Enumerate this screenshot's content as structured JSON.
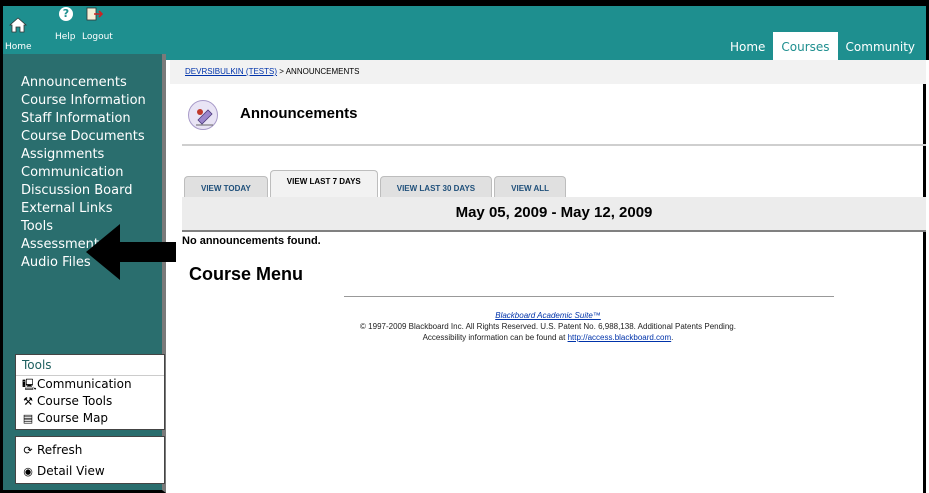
{
  "topbar": {
    "home_label": "Home",
    "help_label": "Help",
    "logout_label": "Logout",
    "help_glyph": "?",
    "tabs": [
      {
        "label": "Home",
        "active": false
      },
      {
        "label": "Courses",
        "active": true
      },
      {
        "label": "Community",
        "active": false
      }
    ],
    "bar_color": "#1e8f8f"
  },
  "leftnav": {
    "items": [
      "Announcements",
      "Course Information",
      "Staff Information",
      "Course Documents",
      "Assignments",
      "Communication",
      "Discussion Board",
      "External Links",
      "Tools",
      "Assessments",
      "Audio Files"
    ],
    "tools_box": {
      "title": "Tools",
      "items": [
        {
          "label": "Communication",
          "icon": "computer-icon"
        },
        {
          "label": "Course Tools",
          "icon": "tools-icon"
        },
        {
          "label": "Course Map",
          "icon": "map-icon"
        }
      ]
    },
    "view_box": {
      "items": [
        {
          "label": "Refresh",
          "icon": "refresh-icon"
        },
        {
          "label": "Detail View",
          "icon": "detail-view-icon"
        }
      ]
    },
    "bg_color": "#2a6e6e"
  },
  "main": {
    "breadcrumb": {
      "course": "DEVRSIBULKIN (TESTS)",
      "separator": " > ",
      "current": "ANNOUNCEMENTS"
    },
    "title": "Announcements",
    "view_tabs": [
      {
        "label": "VIEW TODAY",
        "active": false
      },
      {
        "label": "VIEW LAST 7 DAYS",
        "active": true
      },
      {
        "label": "VIEW LAST 30 DAYS",
        "active": false
      },
      {
        "label": "VIEW ALL",
        "active": false
      }
    ],
    "date_range": "May 05, 2009 - May 12, 2009",
    "no_announcements": "No announcements found.",
    "course_menu_heading": "Course Menu",
    "footer": {
      "product": "Blackboard Academic Suite™",
      "copyright": "© 1997-2009 Blackboard Inc. All Rights Reserved. U.S. Patent No. 6,988,138. Additional Patents Pending.",
      "access_prefix": "Accessibility information can be found at ",
      "access_link": "http://access.blackboard.com",
      "access_suffix": "."
    }
  }
}
